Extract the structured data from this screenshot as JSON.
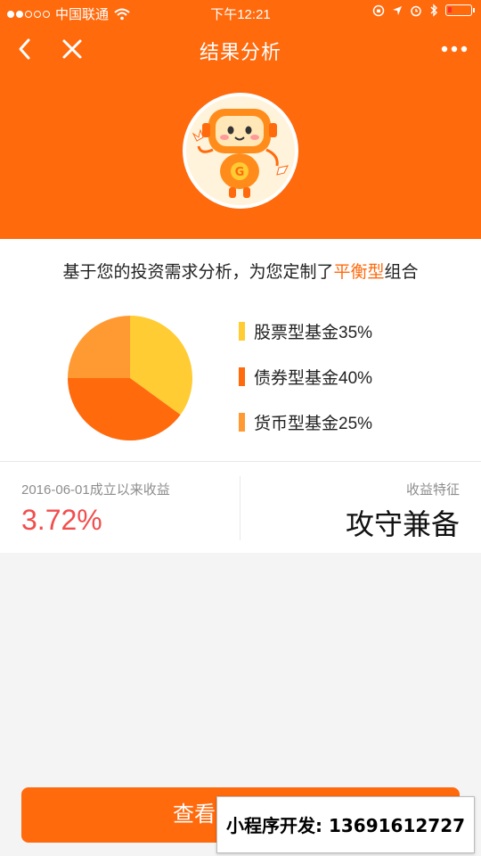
{
  "status_bar": {
    "carrier": "中国联通",
    "time": "下午12:21"
  },
  "nav": {
    "title": "结果分析",
    "icons": {
      "back": "chevron-left-icon",
      "close": "close-icon",
      "more": "more-dots-icon"
    }
  },
  "summary": {
    "prefix": "基于您的投资需求分析，为您定制了",
    "highlight": "平衡型",
    "suffix": "组合"
  },
  "chart_data": {
    "type": "pie",
    "slices": [
      {
        "label": "股票型基金35%",
        "value": 35,
        "color": "#ffcc33"
      },
      {
        "label": "债券型基金40%",
        "value": 40,
        "color": "#ff6a0d"
      },
      {
        "label": "货币型基金25%",
        "value": 25,
        "color": "#ff9a33"
      }
    ],
    "legend_position": "right"
  },
  "stats": {
    "return_label": "2016-06-01成立以来收益",
    "return_value": "3.72%",
    "feature_label": "收益特征",
    "feature_value": "攻守兼备"
  },
  "bottom_button": {
    "label": "查看"
  },
  "watermark": {
    "text": "小程序开发: 13691612727"
  },
  "colors": {
    "brand": "#ff6a0d",
    "return_red": "#f24d4d"
  }
}
